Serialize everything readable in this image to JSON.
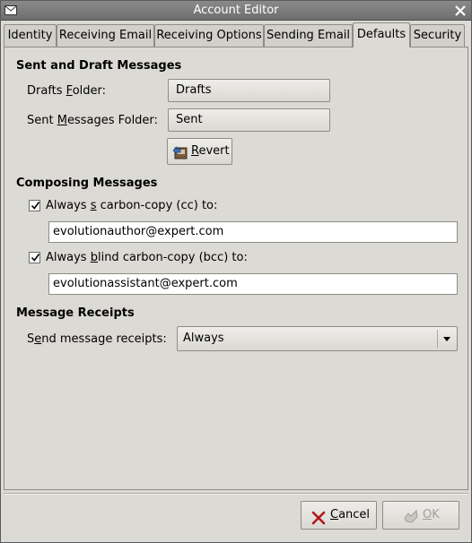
{
  "window": {
    "title": "Account Editor"
  },
  "tabs": [
    {
      "label": "Identity"
    },
    {
      "label": "Receiving Email"
    },
    {
      "label": "Receiving Options"
    },
    {
      "label": "Sending Email"
    },
    {
      "label": "Defaults"
    },
    {
      "label": "Security"
    }
  ],
  "active_tab": "Defaults",
  "sent_draft": {
    "heading": "Sent and Draft Messages",
    "drafts_label_pre": "Drafts ",
    "drafts_label_u": "F",
    "drafts_label_post": "older:",
    "drafts_value": "Drafts",
    "sent_label_pre": "Sent ",
    "sent_label_u": "M",
    "sent_label_post": "essages Folder:",
    "sent_value": "Sent",
    "revert_u": "R",
    "revert_post": "evert"
  },
  "composing": {
    "heading": "Composing Messages",
    "cc_label_pre": "Always ",
    "cc_label_u": "s",
    "cc_label_post": " carbon-copy (cc) to:",
    "cc_checked": true,
    "cc_value": "evolutionauthor@expert.com",
    "bcc_label_pre": "Always ",
    "bcc_label_u": "b",
    "bcc_label_post": "lind carbon-copy (bcc) to:",
    "bcc_checked": true,
    "bcc_value": "evolutionassistant@expert.com"
  },
  "receipts": {
    "heading": "Message Receipts",
    "label_pre": "S",
    "label_u": "e",
    "label_post": "nd message receipts:",
    "value": "Always"
  },
  "footer": {
    "cancel_u": "C",
    "cancel_post": "ancel",
    "ok_u": "O",
    "ok_post": "K"
  }
}
